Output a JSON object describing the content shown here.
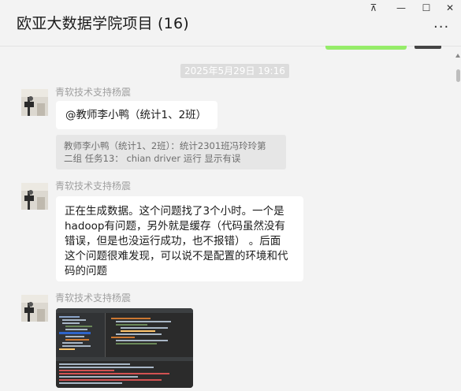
{
  "window": {
    "title": "欧亚大数据学院项目 (16)",
    "controls": {
      "pin": "⊼",
      "minimize": "—",
      "maximize": "☐",
      "close": "✕"
    },
    "more": "···"
  },
  "chat": {
    "timestamp": "2025年5月29日 19:16",
    "messages": [
      {
        "sender": "青软技术支持杨震",
        "text": "@教师李小鸭（统计1、2班）",
        "quote_lines": [
          "教师李小鸭（统计1、2班）：统计2301班冯玲玲第",
          "二组 任务13： chian driver 运行 显示有误"
        ]
      },
      {
        "sender": "青软技术支持杨震",
        "text_lines": [
          "正在生成数据。这个问题找了3个小时。一个是",
          "hadoop有问题，另外就是缓存（代码虽然没有",
          "错误，但是也没运行成功，也不报错）  。后面",
          "这个问题很难发现，可以说不是配置的环境和代",
          "码的问题"
        ]
      },
      {
        "sender": "青软技术支持杨震",
        "image": "code-editor-screenshot"
      }
    ]
  },
  "colors": {
    "background": "#f3f3f3",
    "bubble": "#ffffff",
    "quote": "#e6e6e6",
    "sent_accent": "#95ec69",
    "sender_name": "#a0a0a0"
  }
}
